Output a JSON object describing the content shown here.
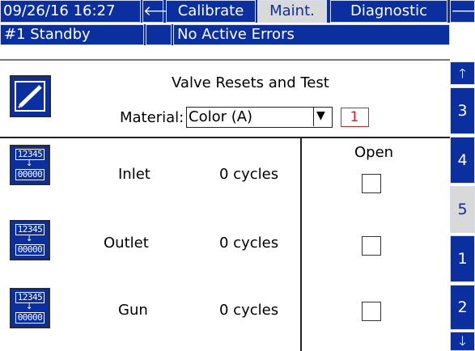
{
  "header": {
    "datetime": "09/26/16 16:27",
    "nav_left_glyph": "🡐",
    "tabs": [
      {
        "label": "Calibrate"
      },
      {
        "label": "Maint."
      },
      {
        "label": "Diagnostic"
      }
    ],
    "nav_right_glyph": "🡒",
    "selected_tab": "Maint."
  },
  "status": {
    "unit": "#1 Standby",
    "errors": "No Active Errors"
  },
  "panel": {
    "title": "Valve Resets and Test",
    "material_label": "Material:",
    "material_value": "Color (A)",
    "dropdown_glyph": "▼",
    "material_index": "1",
    "open_header": "Open"
  },
  "valves": [
    {
      "name": "Inlet",
      "cycles": "0 cycles",
      "open": false
    },
    {
      "name": "Outlet",
      "cycles": "0 cycles",
      "open": false
    },
    {
      "name": "Gun",
      "cycles": "0 cycles",
      "open": false
    }
  ],
  "counter_icon": {
    "top": "12345",
    "bottom": "00000",
    "arrow": "↓"
  },
  "side_tabs": {
    "up_glyph": "🡑",
    "pages": [
      "3",
      "4",
      "5",
      "1",
      "2"
    ],
    "selected_page": "5",
    "down_glyph": "🡓"
  },
  "colors": {
    "accent": "#0b2f9e",
    "selected": "#d9d9d9",
    "index_red": "#e02020"
  }
}
